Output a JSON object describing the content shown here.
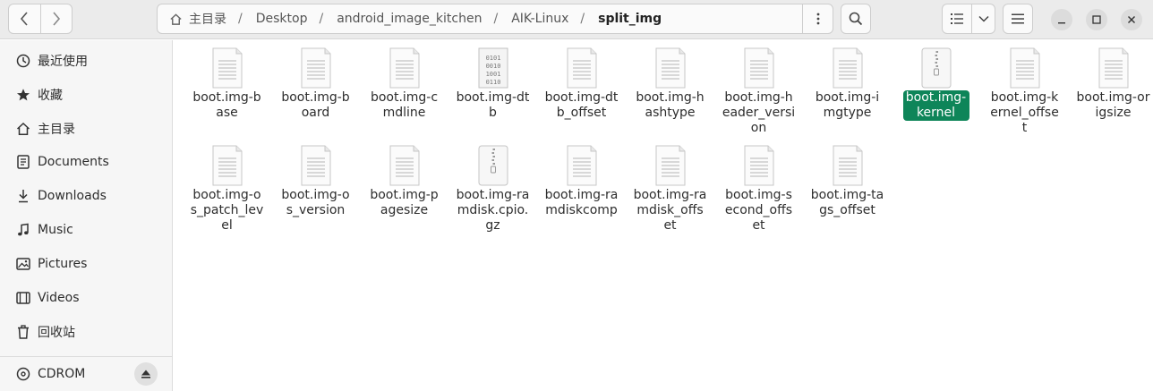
{
  "header": {
    "path": [
      {
        "label": "主目录"
      },
      {
        "label": "Desktop"
      },
      {
        "label": "android_image_kitchen"
      },
      {
        "label": "AIK-Linux"
      },
      {
        "label": "split_img"
      }
    ]
  },
  "sidebar": {
    "items": [
      {
        "label": "最近使用",
        "icon": "clock-icon"
      },
      {
        "label": "收藏",
        "icon": "star-icon"
      },
      {
        "label": "主目录",
        "icon": "home-icon"
      },
      {
        "label": "Documents",
        "icon": "document-icon"
      },
      {
        "label": "Downloads",
        "icon": "download-icon"
      },
      {
        "label": "Music",
        "icon": "music-icon"
      },
      {
        "label": "Pictures",
        "icon": "picture-icon"
      },
      {
        "label": "Videos",
        "icon": "video-icon"
      },
      {
        "label": "回收站",
        "icon": "trash-icon"
      }
    ],
    "devices": [
      {
        "label": "CDROM",
        "icon": "disc-icon"
      }
    ]
  },
  "files": [
    {
      "name": "boot.img-base",
      "icon": "text",
      "selected": false
    },
    {
      "name": "boot.img-board",
      "icon": "text",
      "selected": false
    },
    {
      "name": "boot.img-cmdline",
      "icon": "text",
      "selected": false
    },
    {
      "name": "boot.img-dtb",
      "icon": "binary",
      "selected": false
    },
    {
      "name": "boot.img-dtb_offset",
      "icon": "text",
      "selected": false
    },
    {
      "name": "boot.img-hashtype",
      "icon": "text",
      "selected": false
    },
    {
      "name": "boot.img-header_version",
      "icon": "text",
      "selected": false
    },
    {
      "name": "boot.img-imgtype",
      "icon": "text",
      "selected": false
    },
    {
      "name": "boot.img-kernel",
      "icon": "archive",
      "selected": true
    },
    {
      "name": "boot.img-kernel_offset",
      "icon": "text",
      "selected": false
    },
    {
      "name": "boot.img-origsize",
      "icon": "text",
      "selected": false
    },
    {
      "name": "boot.img-os_patch_level",
      "icon": "text",
      "selected": false
    },
    {
      "name": "boot.img-os_version",
      "icon": "text",
      "selected": false
    },
    {
      "name": "boot.img-pagesize",
      "icon": "text",
      "selected": false
    },
    {
      "name": "boot.img-ramdisk.cpio.gz",
      "icon": "archive",
      "selected": false
    },
    {
      "name": "boot.img-ramdiskcomp",
      "icon": "text",
      "selected": false
    },
    {
      "name": "boot.img-ramdisk_offset",
      "icon": "text",
      "selected": false
    },
    {
      "name": "boot.img-second_offset",
      "icon": "text",
      "selected": false
    },
    {
      "name": "boot.img-tags_offset",
      "icon": "text",
      "selected": false
    }
  ],
  "colors": {
    "selection": "#0e8559",
    "header_bg": "#ebebeb",
    "sidebar_bg": "#f6f6f6"
  }
}
